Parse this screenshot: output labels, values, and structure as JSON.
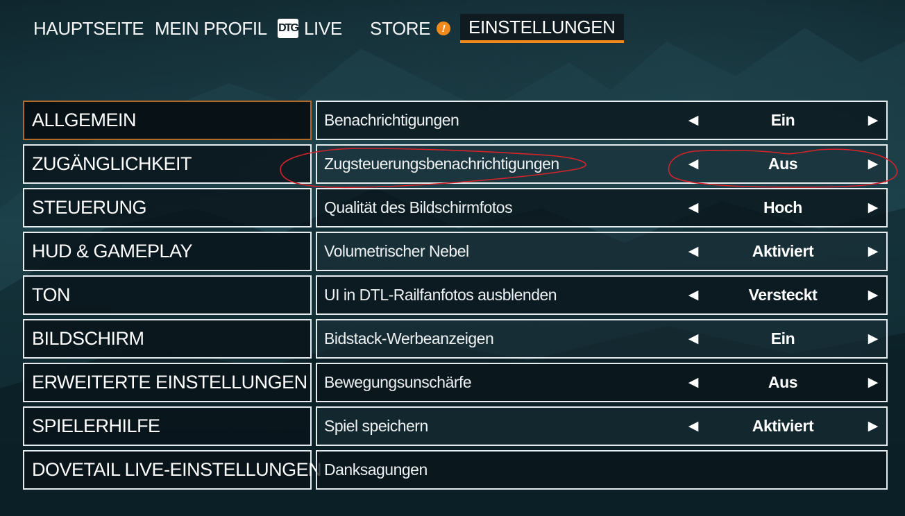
{
  "colors": {
    "accent": "#f08a1c",
    "annotation": "#d4232a",
    "border": "#e7ecee"
  },
  "nav": {
    "items": [
      {
        "label": "HAUPTSEITE"
      },
      {
        "label": "MEIN PROFIL"
      },
      {
        "label": "LIVE",
        "icon": "dtg-logo-icon",
        "logo_text": "DTG"
      },
      {
        "label": "STORE",
        "icon": "alert-icon",
        "badge": "!"
      },
      {
        "label": "EINSTELLUNGEN",
        "active": true
      }
    ]
  },
  "categories": [
    {
      "label": "ALLGEMEIN",
      "active": true
    },
    {
      "label": "ZUGÄNGLICHKEIT"
    },
    {
      "label": "STEUERUNG"
    },
    {
      "label": "HUD & GAMEPLAY"
    },
    {
      "label": "TON"
    },
    {
      "label": "BILDSCHIRM"
    },
    {
      "label": "ERWEITERTE EINSTELLUNGEN"
    },
    {
      "label": "SPIELERHILFE"
    },
    {
      "label": "DOVETAIL LIVE-EINSTELLUNGEN"
    }
  ],
  "settings": [
    {
      "label": "Benachrichtigungen",
      "value": "Ein"
    },
    {
      "label": "Zugsteuerungsbenachrichtigungen",
      "value": "Aus"
    },
    {
      "label": "Qualität des Bildschirmfotos",
      "value": "Hoch"
    },
    {
      "label": "Volumetrischer Nebel",
      "value": "Aktiviert"
    },
    {
      "label": "UI in DTL-Railfanfotos ausblenden",
      "value": "Versteckt"
    },
    {
      "label": "Bidstack-Werbeanzeigen",
      "value": "Ein"
    },
    {
      "label": "Bewegungsunschärfe",
      "value": "Aus"
    },
    {
      "label": "Spiel speichern",
      "value": "Aktiviert"
    },
    {
      "label": "Danksagungen"
    }
  ],
  "arrows": {
    "left": "◀",
    "right": "▶"
  }
}
